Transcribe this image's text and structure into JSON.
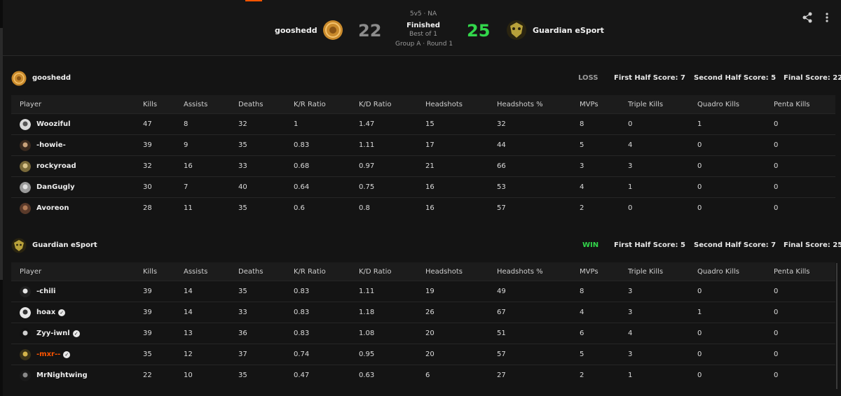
{
  "header": {
    "team_left": {
      "name": "gooshedd",
      "score": "22",
      "score_color": "#8c8c8c",
      "logo_color": "#c98a2c"
    },
    "team_right": {
      "name": "Guardian eSport",
      "score": "25",
      "score_color": "#32d74b",
      "logo_color": "#b8a13a"
    },
    "format": "5v5 · NA",
    "status": "Finished",
    "best_of": "Best of 1",
    "stage": "Group A · Round 1",
    "share_icon": "share-icon",
    "more_icon": "more-vertical-icon"
  },
  "columns": [
    "Player",
    "Kills",
    "Assists",
    "Deaths",
    "K/R Ratio",
    "K/D Ratio",
    "Headshots",
    "Headshots %",
    "MVPs",
    "Triple Kills",
    "Quadro Kills",
    "Penta Kills"
  ],
  "teams": [
    {
      "name": "gooshedd",
      "result": "LOSS",
      "result_color": "#9a9a9a",
      "first_half": "First Half Score: 7",
      "second_half": "Second Half Score: 5",
      "final": "Final Score: 22",
      "players": [
        {
          "name": "Wooziful",
          "verified": false,
          "name_color": "#ededed",
          "stats": [
            "47",
            "8",
            "32",
            "1",
            "1.47",
            "15",
            "32",
            "8",
            "0",
            "1",
            "0"
          ]
        },
        {
          "name": "-howie-",
          "verified": false,
          "name_color": "#ededed",
          "stats": [
            "39",
            "9",
            "35",
            "0.83",
            "1.11",
            "17",
            "44",
            "5",
            "4",
            "0",
            "0"
          ]
        },
        {
          "name": "rockyroad",
          "verified": false,
          "name_color": "#ededed",
          "stats": [
            "32",
            "16",
            "33",
            "0.68",
            "0.97",
            "21",
            "66",
            "3",
            "3",
            "0",
            "0"
          ]
        },
        {
          "name": "DanGugly",
          "verified": false,
          "name_color": "#ededed",
          "stats": [
            "30",
            "7",
            "40",
            "0.64",
            "0.75",
            "16",
            "53",
            "4",
            "1",
            "0",
            "0"
          ]
        },
        {
          "name": "Avoreon",
          "verified": false,
          "name_color": "#ededed",
          "stats": [
            "28",
            "11",
            "35",
            "0.6",
            "0.8",
            "16",
            "57",
            "2",
            "0",
            "0",
            "0"
          ]
        }
      ]
    },
    {
      "name": "Guardian eSport",
      "result": "WIN",
      "result_color": "#32d74b",
      "first_half": "First Half Score: 5",
      "second_half": "Second Half Score: 7",
      "final": "Final Score: 25",
      "players": [
        {
          "name": "-chili",
          "verified": false,
          "name_color": "#ededed",
          "stats": [
            "39",
            "14",
            "35",
            "0.83",
            "1.11",
            "19",
            "49",
            "8",
            "3",
            "0",
            "0"
          ]
        },
        {
          "name": "hoax",
          "verified": true,
          "name_color": "#ededed",
          "stats": [
            "39",
            "14",
            "33",
            "0.83",
            "1.18",
            "26",
            "67",
            "4",
            "3",
            "1",
            "0"
          ]
        },
        {
          "name": "Zyy-iwnl",
          "verified": true,
          "name_color": "#ededed",
          "stats": [
            "39",
            "13",
            "36",
            "0.83",
            "1.08",
            "20",
            "51",
            "6",
            "4",
            "0",
            "0"
          ]
        },
        {
          "name": "-mxr--",
          "verified": true,
          "name_color": "#ff5500",
          "stats": [
            "35",
            "12",
            "37",
            "0.74",
            "0.95",
            "20",
            "57",
            "5",
            "3",
            "0",
            "0"
          ]
        },
        {
          "name": "MrNightwing",
          "verified": false,
          "name_color": "#ededed",
          "stats": [
            "22",
            "10",
            "35",
            "0.47",
            "0.63",
            "6",
            "27",
            "2",
            "1",
            "0",
            "0"
          ]
        }
      ]
    }
  ]
}
